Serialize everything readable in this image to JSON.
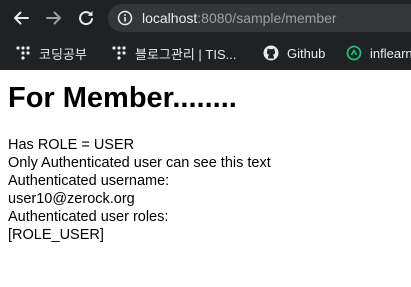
{
  "browser": {
    "url_host": "localhost",
    "url_rest": ":8080/sample/member",
    "bookmarks": [
      {
        "label": "코딩공부",
        "icon": "dots-favicon-icon"
      },
      {
        "label": "블로그관리 | TIS...",
        "icon": "dots-favicon-icon"
      },
      {
        "label": "Github",
        "icon": "github-icon"
      },
      {
        "label": "inflearn",
        "icon": "inflearn-icon"
      }
    ],
    "colors": {
      "frame": "#202124",
      "omnibox": "#35363a",
      "text": "#e8eaed",
      "muted": "#9aa0a6"
    }
  },
  "page": {
    "heading": "For Member........",
    "lines": [
      "Has ROLE = USER",
      "Only Authenticated user can see this text",
      "Authenticated username:",
      "user10@zerock.org",
      "Authenticated user roles:",
      "[ROLE_USER]"
    ]
  }
}
